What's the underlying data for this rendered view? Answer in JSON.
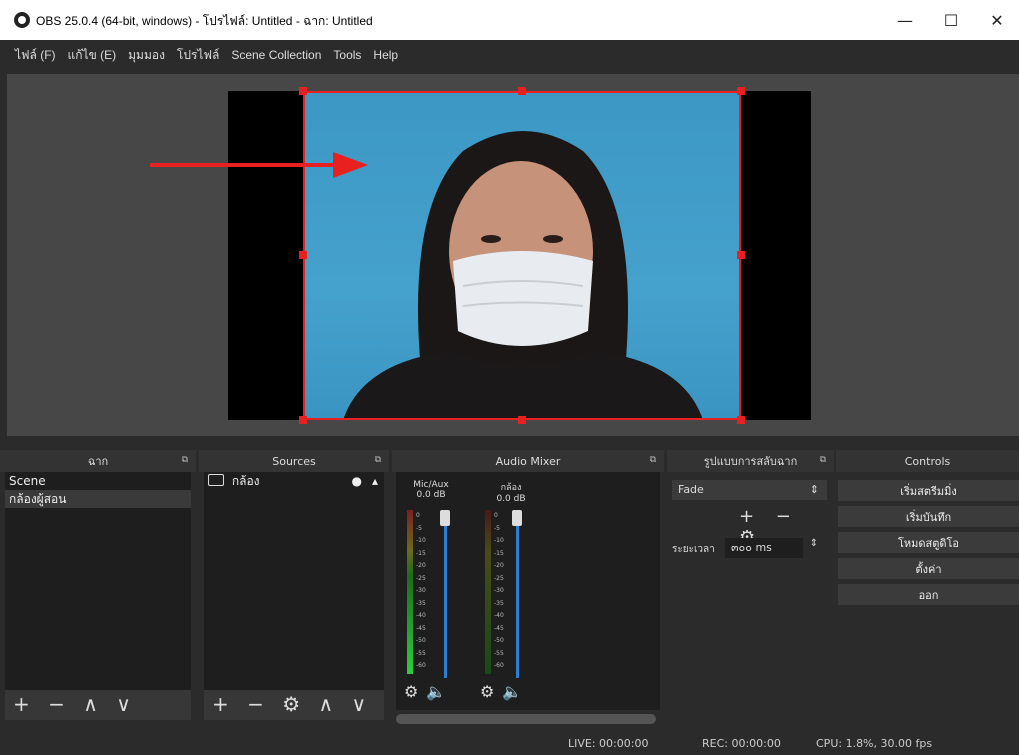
{
  "window": {
    "title": "OBS 25.0.4 (64-bit, windows) - โปรไฟล์: Untitled - ฉาก: Untitled",
    "minimize": "—",
    "maximize": "☐",
    "close": "✕"
  },
  "menu": [
    "ไฟล์ (F)",
    "แก้ไข (E)",
    "มุมมอง",
    "โปรไฟล์",
    "Scene Collection",
    "Tools",
    "Help"
  ],
  "scenes": {
    "title": "ฉาก",
    "items": [
      "Scene",
      "กล้องผู้สอน"
    ],
    "tools": "+ − ∧ ∨"
  },
  "sources": {
    "title": "Sources",
    "items": [
      "กล้อง"
    ],
    "tools": "+ − ⚙ ∧ ∨"
  },
  "mixer": {
    "title": "Audio Mixer",
    "channels": [
      {
        "name": "Mic/Aux",
        "db": "0.0 dB"
      },
      {
        "name": "กล้อง",
        "db": "0.0 dB"
      }
    ],
    "scale": [
      "0",
      "-5",
      "-10",
      "-15",
      "-20",
      "-25",
      "-30",
      "-35",
      "-40",
      "-45",
      "-50",
      "-55",
      "-60"
    ]
  },
  "transitions": {
    "title": "รูปแบบการสลับฉาก",
    "selected": "Fade",
    "duration_label": "ระยะเวลา",
    "duration_value": "๓๐๐ ms",
    "tools": "+ − ⚙"
  },
  "controls": {
    "title": "Controls",
    "buttons": [
      "เริ่มสตรีมมิ่ง",
      "เริ่มบันทึก",
      "โหมดสตูดิโอ",
      "ตั้งค่า",
      "ออก"
    ]
  },
  "status": {
    "live": "LIVE: 00:00:00",
    "rec": "REC: 00:00:00",
    "cpu": "CPU: 1.8%, 30.00 fps"
  },
  "colors": {
    "selection": "#e82020",
    "background": "#2b2b2b",
    "meter_green": "#2ecc40",
    "volume_blue": "#2d7fd3"
  }
}
